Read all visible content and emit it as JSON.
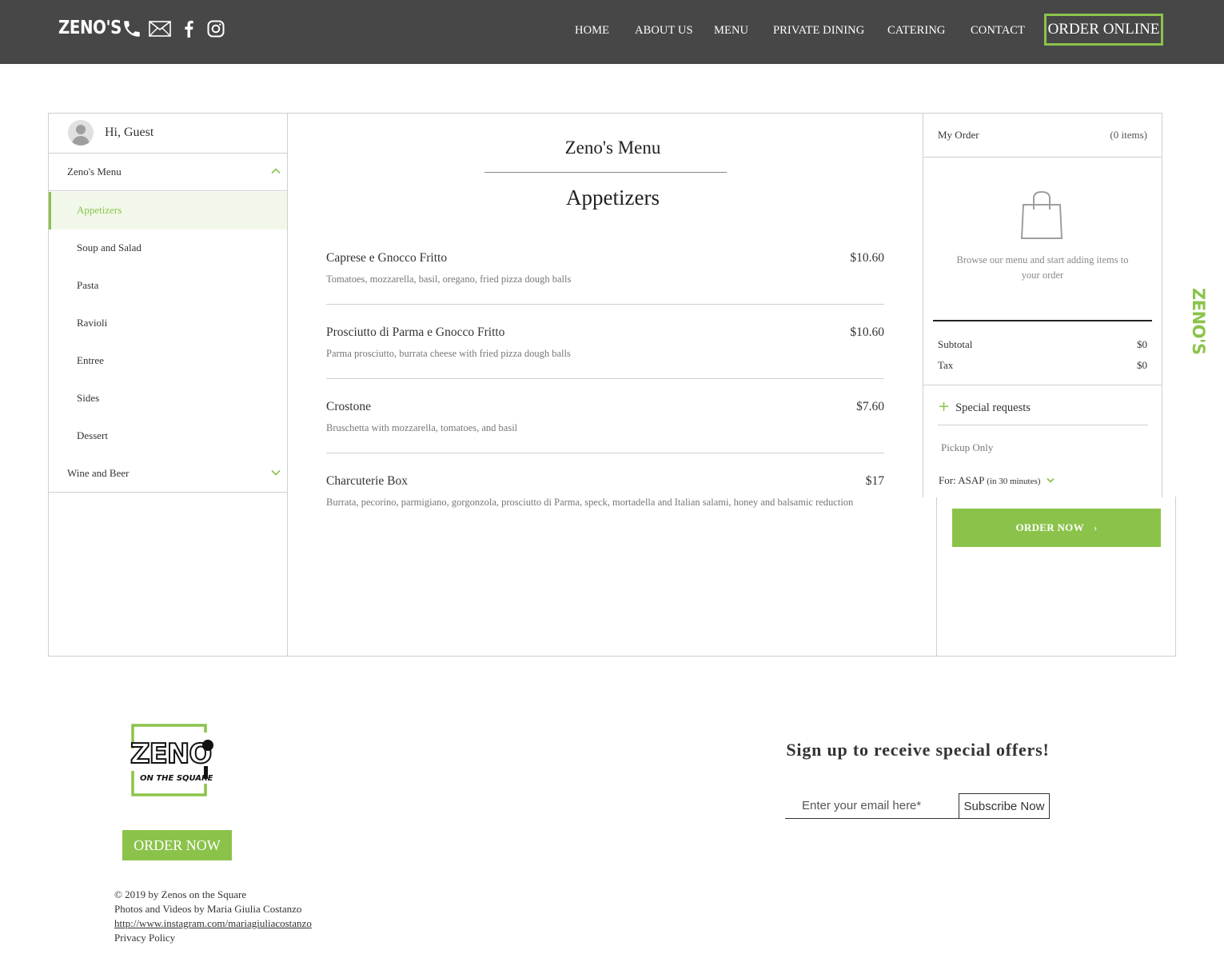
{
  "header": {
    "brand": "ZENO'S",
    "icons": [
      "phone-icon",
      "mail-icon",
      "facebook-icon",
      "instagram-icon"
    ],
    "nav": [
      "HOME",
      "ABOUT US",
      "MENU",
      "PRIVATE DINING",
      "CATERING",
      "CONTACT"
    ],
    "order_online": "ORDER ONLINE"
  },
  "sidebar": {
    "greeting": "Hi, Guest",
    "menu_section": "Zeno's Menu",
    "categories": [
      "Appetizers",
      "Soup and Salad",
      "Pasta",
      "Ravioli",
      "Entree",
      "Sides",
      "Dessert"
    ],
    "active_category": "Appetizers",
    "wine_section": "Wine and Beer"
  },
  "menu": {
    "title": "Zeno's Menu",
    "section": "Appetizers",
    "items": [
      {
        "name": "Caprese e Gnocco Fritto",
        "price": "$10.60",
        "desc": "Tomatoes, mozzarella, basil, oregano, fried pizza dough balls"
      },
      {
        "name": "Prosciutto di Parma e Gnocco Fritto",
        "price": "$10.60",
        "desc": "Parma prosciutto, burrata cheese with fried pizza dough balls"
      },
      {
        "name": "Crostone",
        "price": "$7.60",
        "desc": "Bruschetta with mozzarella, tomatoes, and basil"
      },
      {
        "name": "Charcuterie Box",
        "price": "$17",
        "desc": "Burrata, pecorino, parmigiano, gorgonzola, prosciutto di Parma, speck, mortadella and Italian salami, honey and balsamic reduction"
      }
    ]
  },
  "order": {
    "title": "My Order",
    "count": "(0 items)",
    "empty_message": "Browse our menu and start adding items to your order",
    "subtotal_label": "Subtotal",
    "subtotal": "$0",
    "tax_label": "Tax",
    "tax": "$0",
    "special_requests": "Special requests",
    "pickup": "Pickup Only",
    "for_label": "For: ASAP",
    "for_note": "(in 30 minutes)",
    "order_now": "ORDER NOW",
    "side_logo": "ZENO'S"
  },
  "footer": {
    "logo_text": "ZENO",
    "logo_sub": "ON THE SQUARE",
    "order_now": "ORDER NOW",
    "copyright": "© 2019 by Zenos on the Square",
    "photos": "Photos and Videos by Maria Giulia Costanzo",
    "link": "http://www.instagram.com/mariagiuliacostanzo",
    "privacy": "Privacy Policy",
    "signup_title": "Sign up to receive special offers!",
    "email_placeholder": "Enter your email here*",
    "subscribe": "Subscribe Now"
  },
  "colors": {
    "accent": "#8bc34a",
    "header_bg": "#474747"
  }
}
